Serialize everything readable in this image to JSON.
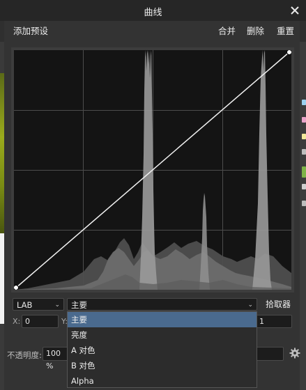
{
  "window": {
    "title": "曲线"
  },
  "toolbar": {
    "add_preset": "添加预设",
    "merge": "合并",
    "delete": "删除",
    "reset": "重置"
  },
  "channel_select": {
    "value": "LAB"
  },
  "component_select": {
    "value": "主要"
  },
  "picker_label": "拾取器",
  "coords": {
    "x_label": "X:",
    "x_value": "0",
    "y_label": "Y:",
    "right_value": "1"
  },
  "opacity": {
    "label": "不透明度:",
    "value": "100 %"
  },
  "dropdown": {
    "items": [
      "主要",
      "亮度",
      "A 对色",
      "B 对色",
      "Alpha"
    ],
    "selected_index": 0
  },
  "colors": {
    "accent": "#4a6a8e",
    "graph_bg": "#141414",
    "histogram": "#8a8a8a"
  }
}
